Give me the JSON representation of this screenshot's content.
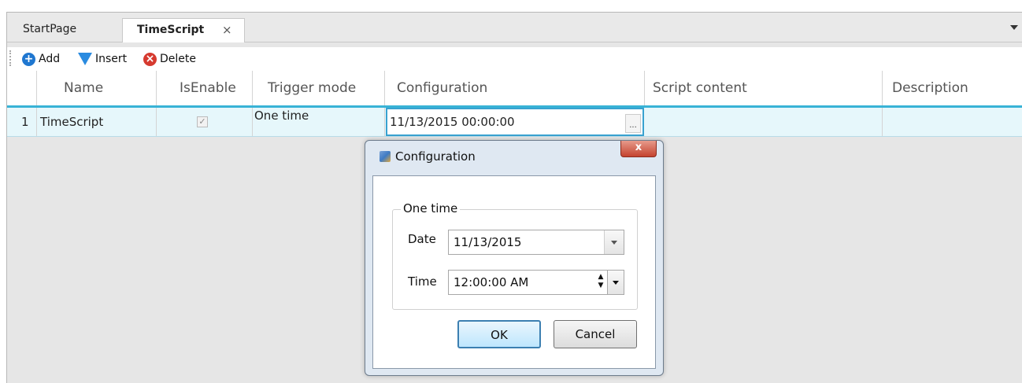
{
  "tabs": [
    {
      "label": "StartPage",
      "active": false
    },
    {
      "label": "TimeScript",
      "active": true,
      "close": "×"
    }
  ],
  "toolbar": {
    "add_label": "Add",
    "insert_label": "Insert",
    "delete_label": "Delete",
    "add_icon": "plus-circle-icon",
    "insert_icon": "insert-arrow-icon",
    "delete_icon": "x-circle-icon"
  },
  "grid": {
    "headers": [
      "Name",
      "IsEnable",
      "Trigger mode",
      "Configuration",
      "Script content",
      "Description"
    ],
    "rows": [
      {
        "index": "1",
        "name": "TimeScript",
        "is_enable": true,
        "check_mark": "✓",
        "trigger_mode": "One time",
        "configuration": "11/13/2015 00:00:00",
        "ellipsis": "...",
        "script_content": "",
        "description": ""
      }
    ]
  },
  "dialog": {
    "title": "Configuration",
    "close": "x",
    "group_label": "One time",
    "date_label": "Date",
    "date_value": "11/13/2015",
    "time_label": "Time",
    "time_value": "12:00:00 AM",
    "ok_label": "OK",
    "cancel_label": "Cancel"
  },
  "colors": {
    "accent": "#38b3d6",
    "row_selected": "#e6f7fb",
    "close_button": "#c4432f"
  }
}
